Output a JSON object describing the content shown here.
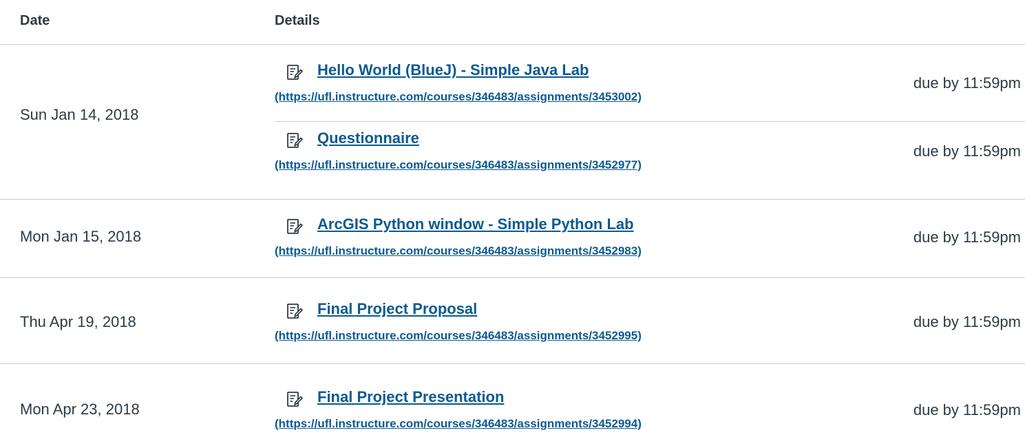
{
  "table": {
    "headers": {
      "date": "Date",
      "details": "Details"
    },
    "groups": [
      {
        "date": "Sun Jan 14, 2018",
        "items": [
          {
            "icon": "assignment-icon",
            "title": "Hello World (BlueJ) - Simple Java Lab",
            "url": "(https://ufl.instructure.com/courses/346483/assignments/3453002)",
            "due": "due by 11:59pm"
          },
          {
            "icon": "assignment-icon",
            "title": "Questionnaire",
            "url": "(https://ufl.instructure.com/courses/346483/assignments/3452977)",
            "due": "due by 11:59pm"
          }
        ]
      },
      {
        "date": "Mon Jan 15, 2018",
        "items": [
          {
            "icon": "assignment-icon",
            "title": "ArcGIS Python window - Simple Python Lab",
            "url": "(https://ufl.instructure.com/courses/346483/assignments/3452983)",
            "due": "due by 11:59pm"
          }
        ]
      },
      {
        "date": "Thu Apr 19, 2018",
        "items": [
          {
            "icon": "assignment-icon",
            "title": "Final Project Proposal",
            "url": "(https://ufl.instructure.com/courses/346483/assignments/3452995)",
            "due": "due by 11:59pm"
          }
        ]
      },
      {
        "date": "Mon Apr 23, 2018",
        "items": [
          {
            "icon": "assignment-icon",
            "title": "Final Project Presentation",
            "url": "(https://ufl.instructure.com/courses/346483/assignments/3452994)",
            "due": "due by 11:59pm"
          }
        ]
      }
    ]
  }
}
